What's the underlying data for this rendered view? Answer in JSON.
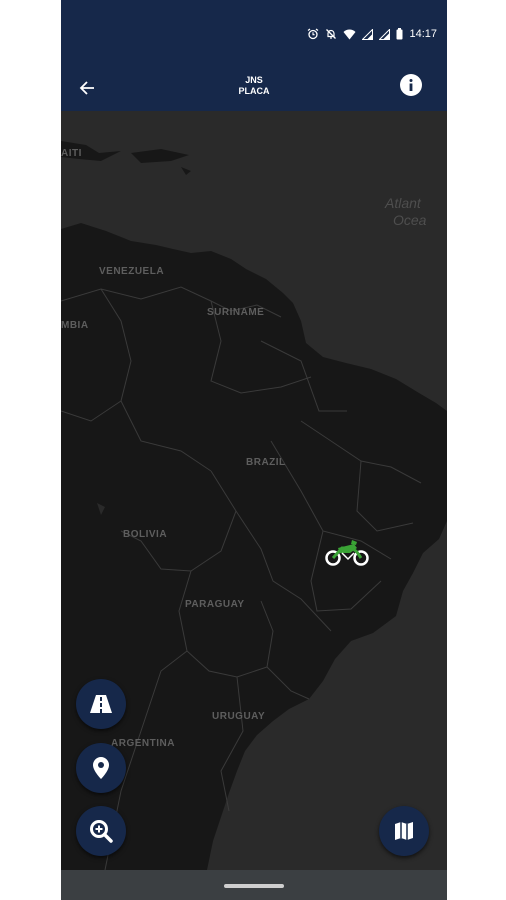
{
  "status_bar": {
    "time": "14:17",
    "icons": [
      "alarm-icon",
      "mute-icon",
      "wifi-icon",
      "signal-icon",
      "signal-icon",
      "battery-icon"
    ]
  },
  "app_bar": {
    "title_line1": "JNS",
    "title_line2": "PLACA",
    "back_icon": "arrow-left-icon",
    "info_icon": "info-icon"
  },
  "map": {
    "labels": {
      "haiti": "AITI",
      "venezuela": "VENEZUELA",
      "suriname": "SURINAME",
      "colombia": "MBIA",
      "brazil": "BRAZIL",
      "bolivia": "BOLIVIA",
      "paraguay": "PARAGUAY",
      "uruguay": "URUGUAY",
      "argentina": "ARGENTINA",
      "ocean_line1": "Atlant",
      "ocean_line2": "Ocea"
    },
    "vehicle_icon": "motorcycle-icon",
    "vehicle_color": "#3aa335"
  },
  "fabs": {
    "road": "road-icon",
    "location": "location-pin-icon",
    "zoom": "zoom-in-icon",
    "map_layers": "map-icon"
  },
  "colors": {
    "primary": "#16284a",
    "land": "#171717",
    "water": "#2a2a2a"
  }
}
